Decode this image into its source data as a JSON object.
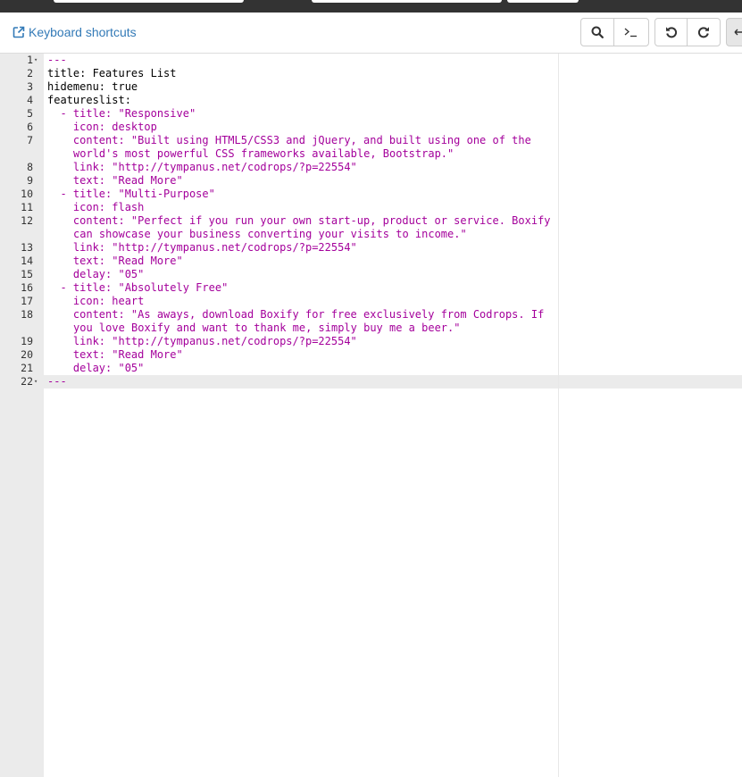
{
  "toolbar": {
    "keyboard_shortcuts_label": "Keyboard shortcuts",
    "icons": [
      "external-link-icon",
      "search-icon",
      "terminal-icon",
      "undo-icon",
      "redo-icon",
      "arrow-left-icon"
    ]
  },
  "editor": {
    "lines": [
      {
        "n": "1",
        "fold": true,
        "parts": [
          {
            "t": "---",
            "c": "marker"
          }
        ]
      },
      {
        "n": "2",
        "parts": [
          {
            "t": "title: Features List",
            "c": "key"
          }
        ]
      },
      {
        "n": "3",
        "parts": [
          {
            "t": "hidemenu: true",
            "c": "key"
          }
        ]
      },
      {
        "n": "4",
        "parts": [
          {
            "t": "featureslist:",
            "c": "key"
          }
        ]
      },
      {
        "n": "5",
        "parts": [
          {
            "t": "  - title: \"Responsive\"",
            "c": "str"
          }
        ]
      },
      {
        "n": "6",
        "parts": [
          {
            "t": "    icon: desktop",
            "c": "str"
          }
        ]
      },
      {
        "n": "7",
        "parts": [
          {
            "t": "    content: \"Built using HTML5/CSS3 and jQuery, and built using one of the",
            "c": "str"
          }
        ],
        "wrap": "world's most powerful CSS frameworks available, Bootstrap.\""
      },
      {
        "n": "8",
        "parts": [
          {
            "t": "    link: \"http://tympanus.net/codrops/?p=22554\"",
            "c": "str"
          }
        ]
      },
      {
        "n": "9",
        "parts": [
          {
            "t": "    text: \"Read More\"",
            "c": "str"
          }
        ]
      },
      {
        "n": "10",
        "parts": [
          {
            "t": "  - title: \"Multi-Purpose\"",
            "c": "str"
          }
        ]
      },
      {
        "n": "11",
        "parts": [
          {
            "t": "    icon: flash",
            "c": "str"
          }
        ]
      },
      {
        "n": "12",
        "parts": [
          {
            "t": "    content: \"Perfect if you run your own start-up, product or service. Boxify",
            "c": "str"
          }
        ],
        "wrap": "can showcase your business converting your visits to income.\""
      },
      {
        "n": "13",
        "parts": [
          {
            "t": "    link: \"http://tympanus.net/codrops/?p=22554\"",
            "c": "str"
          }
        ]
      },
      {
        "n": "14",
        "parts": [
          {
            "t": "    text: \"Read More\"",
            "c": "str"
          }
        ]
      },
      {
        "n": "15",
        "parts": [
          {
            "t": "    delay: \"05\"",
            "c": "str"
          }
        ]
      },
      {
        "n": "16",
        "parts": [
          {
            "t": "  - title: \"Absolutely Free\"",
            "c": "str"
          }
        ]
      },
      {
        "n": "17",
        "parts": [
          {
            "t": "    icon: heart",
            "c": "str"
          }
        ]
      },
      {
        "n": "18",
        "parts": [
          {
            "t": "    content: \"As aways, download Boxify for free exclusively from Codrops. If",
            "c": "str"
          }
        ],
        "wrap": "you love Boxify and want to thank me, simply buy me a beer.\""
      },
      {
        "n": "19",
        "parts": [
          {
            "t": "    link: \"http://tympanus.net/codrops/?p=22554\"",
            "c": "str"
          }
        ]
      },
      {
        "n": "20",
        "parts": [
          {
            "t": "    text: \"Read More\"",
            "c": "str"
          }
        ]
      },
      {
        "n": "21",
        "parts": [
          {
            "t": "    delay: \"05\"",
            "c": "str"
          }
        ]
      },
      {
        "n": "22",
        "fold": true,
        "parts": [
          {
            "t": "---",
            "c": "marker"
          }
        ]
      }
    ]
  }
}
